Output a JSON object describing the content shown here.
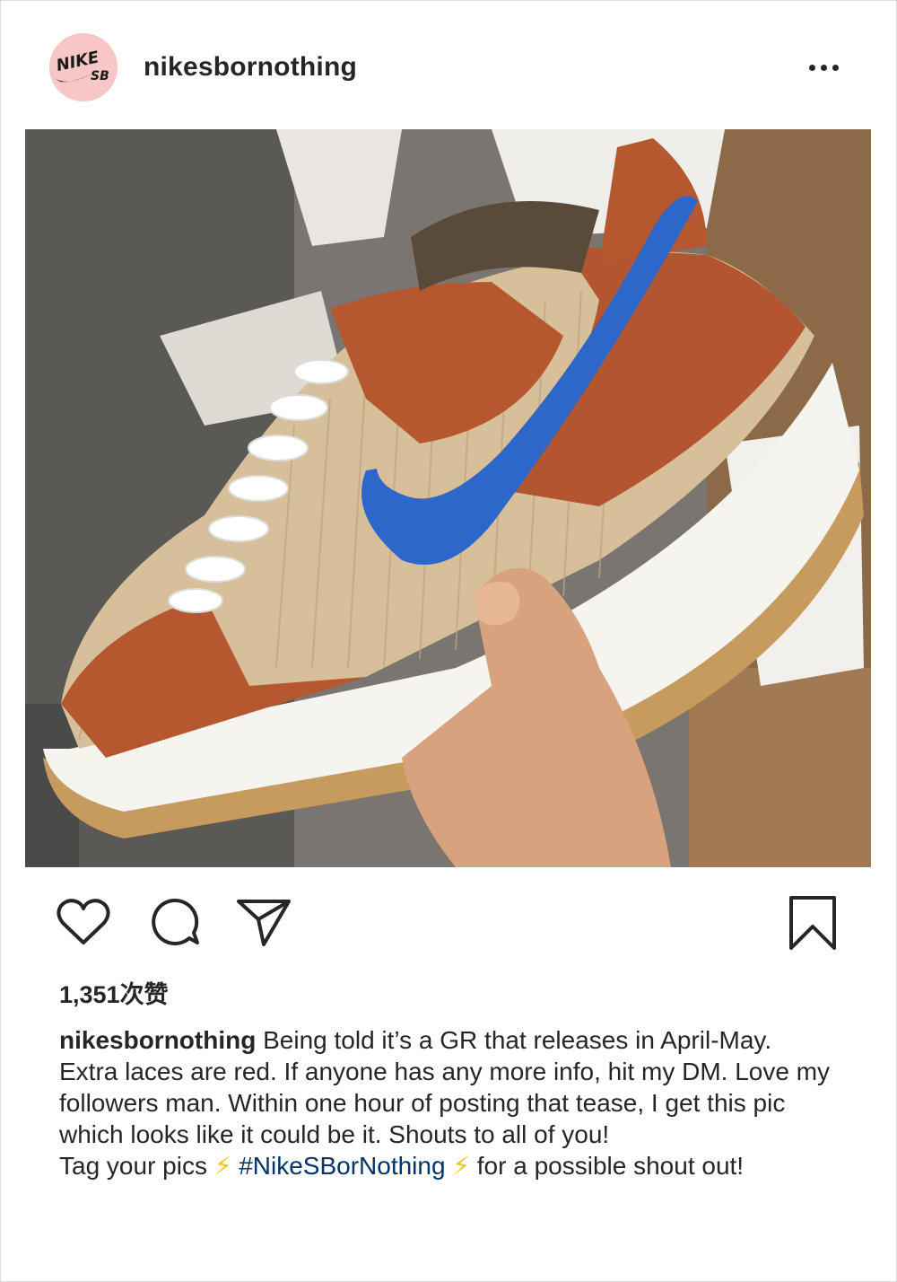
{
  "post": {
    "username": "nikesbornothing",
    "avatar_logo": "NIKE SB",
    "more_icon": "more-horizontal-icon",
    "likes": "1,351次赞",
    "caption": {
      "username": "nikesbornothing",
      "text": "Being told it’s a GR that releases in April-May. Extra laces are red. If anyone has any more info, hit my DM. Love my followers man. Within one hour of posting that tease, I get this pic which looks like it could be it. Shouts to all of you!",
      "line2_prefix": "Tag your pics",
      "bolt": "⚡",
      "hashtag": "#NikeSBorNothing",
      "line2_suffix": "for a possible shout out!"
    }
  },
  "icons": {
    "like": "heart-icon",
    "comment": "comment-icon",
    "share": "paper-plane-icon",
    "save": "bookmark-icon"
  },
  "colors": {
    "text": "#262626",
    "hashtag": "#003569",
    "bolt": "#f5c518",
    "avatar_bg": "#f6c7c6"
  }
}
